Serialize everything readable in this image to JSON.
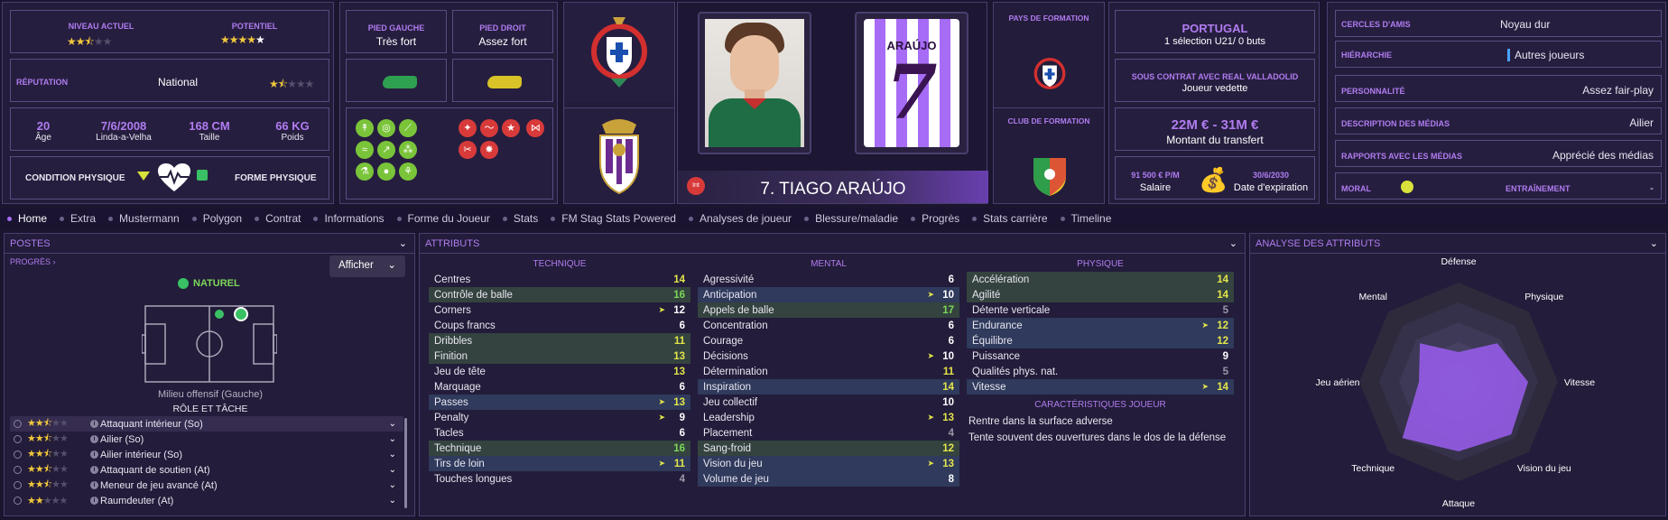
{
  "overview": {
    "niveau_label": "NIVEAU ACTUEL",
    "potentiel_label": "POTENTIEL",
    "reputation_label": "RÉPUTATION",
    "reputation_value": "National",
    "age": "20",
    "age_label": "Âge",
    "birth": "7/6/2008",
    "birthplace": "Linda-a-Velha",
    "height": "168 CM",
    "height_label": "Taille",
    "weight": "66 KG",
    "weight_label": "Poids",
    "condition_label": "CONDITION PHYSIQUE",
    "forme_label": "FORME PHYSIQUE"
  },
  "feet": {
    "left_label": "PIED GAUCHE",
    "left_value": "Très fort",
    "right_label": "PIED DROIT",
    "right_value": "Assez fort"
  },
  "player": {
    "name": "7. TIAGO ARAÚJO",
    "int_badge": "Int",
    "shirt_name": "ARAÚJO",
    "shirt_number": "7"
  },
  "formation": {
    "country_label": "PAYS DE FORMATION",
    "club_label": "CLUB DE FORMATION"
  },
  "nation": {
    "country": "PORTUGAL",
    "caps": "1 sélection U21/ 0 buts",
    "contract_label": "SOUS CONTRAT AVEC REAL VALLADOLID",
    "contract_role": "Joueur vedette",
    "value": "22M € - 31M €",
    "value_label": "Montant du transfert",
    "salary": "91 500 € P/M",
    "salary_label": "Salaire",
    "expiry": "30/6/2030",
    "expiry_label": "Date d'expiration"
  },
  "social": [
    {
      "label": "CERCLES D'AMIS",
      "value": "Noyau dur"
    },
    {
      "label": "HIÉRARCHIE",
      "value": "Autres joueurs"
    },
    {
      "label": "PERSONNALITÉ",
      "value": "Assez fair-play"
    },
    {
      "label": "DESCRIPTION DES MÉDIAS",
      "value": "Ailier"
    },
    {
      "label": "RAPPORTS AVEC LES MÉDIAS",
      "value": "Apprécié des médias"
    },
    {
      "label": "MORAL",
      "value": ""
    },
    {
      "label": "ENTRAÎNEMENT",
      "value": "-"
    }
  ],
  "tabs": [
    "Home",
    "Extra",
    "Mustermann",
    "Polygon",
    "Contrat",
    "Informations",
    "Forme du Joueur",
    "Stats",
    "FM Stag Stats Powered",
    "Analyses de joueur",
    "Blessure/maladie",
    "Progrès",
    "Stats carrière",
    "Timeline"
  ],
  "positions": {
    "title": "POSTES",
    "progress": "PROGRÈS",
    "afficher": "Afficher",
    "naturel": "NATUREL",
    "position_name": "Milieu offensif (Gauche)",
    "role_title": "RÔLE ET TÂCHE",
    "roles": [
      {
        "name": "Attaquant intérieur (So)",
        "stars": 2.5
      },
      {
        "name": "Ailier (So)",
        "stars": 2.5
      },
      {
        "name": "Ailier intérieur (So)",
        "stars": 2.5
      },
      {
        "name": "Attaquant de soutien (At)",
        "stars": 2.5
      },
      {
        "name": "Meneur de jeu avancé (At)",
        "stars": 2.5
      },
      {
        "name": "Raumdeuter (At)",
        "stars": 2
      }
    ]
  },
  "attributes": {
    "title": "ATTRIBUTS",
    "technique_h": "TECHNIQUE",
    "mental_h": "MENTAL",
    "physique_h": "PHYSIQUE",
    "traits_h": "CARACTÉRISTIQUES JOUEUR",
    "technique": [
      {
        "n": "Centres",
        "v": "14",
        "c": "y",
        "h": ""
      },
      {
        "n": "Contrôle de balle",
        "v": "16",
        "c": "g",
        "h": "hg"
      },
      {
        "n": "Corners",
        "v": "12",
        "c": "",
        "h": "",
        "a": 1
      },
      {
        "n": "Coups francs",
        "v": "6",
        "c": "",
        "h": ""
      },
      {
        "n": "Dribbles",
        "v": "11",
        "c": "y",
        "h": "hg"
      },
      {
        "n": "Finition",
        "v": "13",
        "c": "y",
        "h": "hg"
      },
      {
        "n": "Jeu de tête",
        "v": "13",
        "c": "y",
        "h": ""
      },
      {
        "n": "Marquage",
        "v": "6",
        "c": "",
        "h": ""
      },
      {
        "n": "Passes",
        "v": "13",
        "c": "y",
        "h": "hb",
        "a": 1
      },
      {
        "n": "Penalty",
        "v": "9",
        "c": "",
        "h": "",
        "a": 1
      },
      {
        "n": "Tacles",
        "v": "6",
        "c": "",
        "h": ""
      },
      {
        "n": "Technique",
        "v": "16",
        "c": "g",
        "h": "hg"
      },
      {
        "n": "Tirs de loin",
        "v": "11",
        "c": "y",
        "h": "hb",
        "a": 1
      },
      {
        "n": "Touches longues",
        "v": "4",
        "c": "gr",
        "h": ""
      }
    ],
    "mental": [
      {
        "n": "Agressivité",
        "v": "6",
        "c": "",
        "h": ""
      },
      {
        "n": "Anticipation",
        "v": "10",
        "c": "",
        "h": "hb",
        "a": 1
      },
      {
        "n": "Appels de balle",
        "v": "17",
        "c": "g",
        "h": "hg"
      },
      {
        "n": "Concentration",
        "v": "6",
        "c": "",
        "h": ""
      },
      {
        "n": "Courage",
        "v": "6",
        "c": "",
        "h": ""
      },
      {
        "n": "Décisions",
        "v": "10",
        "c": "",
        "h": "",
        "a": 1
      },
      {
        "n": "Détermination",
        "v": "11",
        "c": "y",
        "h": ""
      },
      {
        "n": "Inspiration",
        "v": "14",
        "c": "y",
        "h": "hb"
      },
      {
        "n": "Jeu collectif",
        "v": "10",
        "c": "",
        "h": ""
      },
      {
        "n": "Leadership",
        "v": "13",
        "c": "y",
        "h": "",
        "a": 1
      },
      {
        "n": "Placement",
        "v": "4",
        "c": "gr",
        "h": ""
      },
      {
        "n": "Sang-froid",
        "v": "12",
        "c": "y",
        "h": "hg"
      },
      {
        "n": "Vision du jeu",
        "v": "13",
        "c": "y",
        "h": "hb",
        "a": 1
      },
      {
        "n": "Volume de jeu",
        "v": "8",
        "c": "",
        "h": "hb"
      }
    ],
    "physique": [
      {
        "n": "Accélération",
        "v": "14",
        "c": "y",
        "h": "hg"
      },
      {
        "n": "Agilité",
        "v": "14",
        "c": "y",
        "h": "hg"
      },
      {
        "n": "Détente verticale",
        "v": "5",
        "c": "gr",
        "h": ""
      },
      {
        "n": "Endurance",
        "v": "12",
        "c": "y",
        "h": "hb",
        "a": 1
      },
      {
        "n": "Équilibre",
        "v": "12",
        "c": "y",
        "h": "hb"
      },
      {
        "n": "Puissance",
        "v": "9",
        "c": "",
        "h": ""
      },
      {
        "n": "Qualités phys. nat.",
        "v": "5",
        "c": "gr",
        "h": ""
      },
      {
        "n": "Vitesse",
        "v": "14",
        "c": "y",
        "h": "hb",
        "a": 1
      }
    ],
    "traits": [
      "Rentre dans la surface adverse",
      "Tente souvent des ouvertures dans le dos de la défense"
    ]
  },
  "analysis": {
    "title": "ANALYSE DES ATTRIBUTS",
    "labels": [
      "Défense",
      "Physique",
      "Vitesse",
      "Vision du jeu",
      "Attaque",
      "Technique",
      "Jeu aérien",
      "Mental"
    ],
    "values": [
      0.3,
      0.55,
      0.7,
      0.75,
      0.7,
      0.8,
      0.4,
      0.55
    ]
  },
  "colors": {
    "accent": "#a76cf5",
    "panel": "#231c3a",
    "yellow": "#e3e54a",
    "green": "#7dd75a"
  }
}
